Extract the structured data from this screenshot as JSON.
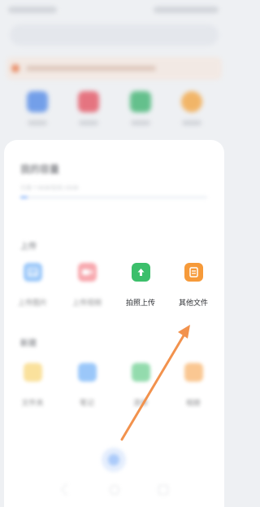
{
  "sheet": {
    "title": "我的容量",
    "storage_text": "已用 7.9GB/空间 15GB",
    "storage_fraction": 0.04,
    "upload_section": "上传",
    "dir_section": "新建",
    "upload_items": [
      {
        "label": "上传图片",
        "icon": "image-icon",
        "color": "#4a9bf5"
      },
      {
        "label": "上传视频",
        "icon": "video-icon",
        "color": "#f2626d"
      },
      {
        "label": "拍照上传",
        "icon": "camera-upload-icon",
        "color": "#3cbf6b"
      },
      {
        "label": "其他文件",
        "icon": "document-icon",
        "color": "#f69a3a"
      }
    ],
    "dir_items": [
      {
        "label": "文件夹",
        "icon": "folder-icon",
        "color": "#f6c94d"
      },
      {
        "label": "笔记",
        "icon": "note-icon",
        "color": "#4a9bf5"
      },
      {
        "label": "清单",
        "icon": "list-icon",
        "color": "#3cbf6b"
      },
      {
        "label": "相册",
        "icon": "album-icon",
        "color": "#f69a3a"
      }
    ]
  },
  "background": {
    "icon_colors": [
      "#4a84e6",
      "#e34b5a",
      "#36b06a",
      "#f3a23a"
    ]
  },
  "annotation": {
    "color": "#f2924d"
  }
}
